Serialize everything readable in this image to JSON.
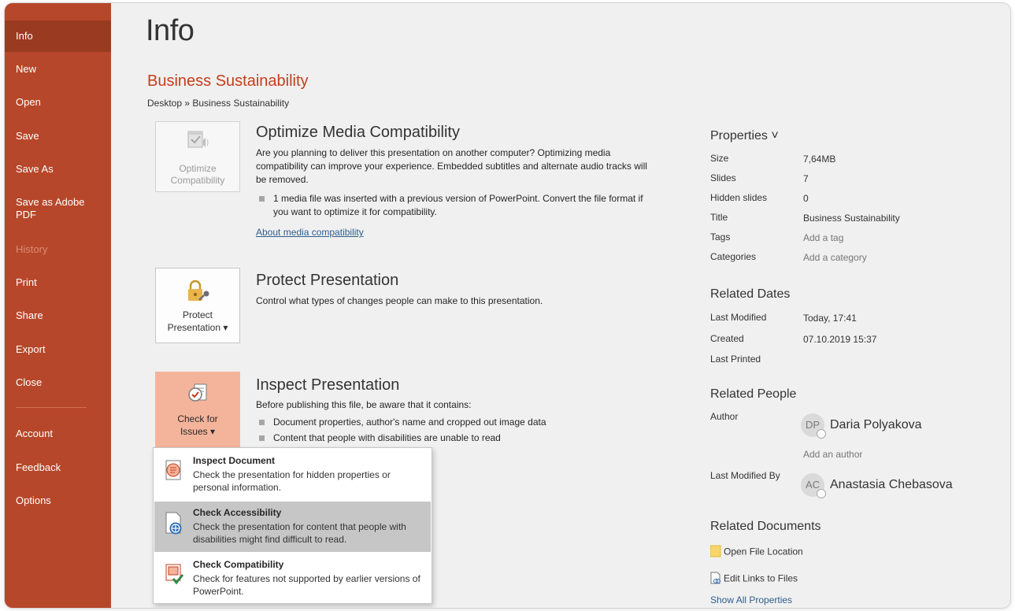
{
  "sidebar": {
    "items": [
      {
        "label": "Info",
        "state": "active"
      },
      {
        "label": "New"
      },
      {
        "label": "Open"
      },
      {
        "label": "Save"
      },
      {
        "label": "Save As"
      },
      {
        "label": "Save as Adobe PDF"
      },
      {
        "label": "History",
        "state": "disabled"
      },
      {
        "label": "Print"
      },
      {
        "label": "Share"
      },
      {
        "label": "Export"
      },
      {
        "label": "Close"
      },
      {
        "label": "Account"
      },
      {
        "label": "Feedback"
      },
      {
        "label": "Options"
      }
    ]
  },
  "main": {
    "page_title": "Info",
    "doc_title": "Business Sustainability",
    "breadcrumb": "Desktop » Business Sustainability",
    "optimize": {
      "tile_label_1": "Optimize",
      "tile_label_2": "Compatibility",
      "heading": "Optimize Media Compatibility",
      "description": "Are you planning to deliver this presentation on another computer? Optimizing media compatibility can improve your experience. Embedded subtitles and alternate audio tracks will be removed.",
      "bullet": "1 media file was inserted with a previous version of PowerPoint. Convert the file format if you want to optimize it for compatibility.",
      "link": "About media compatibility"
    },
    "protect": {
      "tile_label_1": "Protect",
      "tile_label_2": "Presentation ▾",
      "heading": "Protect Presentation",
      "description": "Control what types of changes people can make to this presentation."
    },
    "inspect": {
      "tile_label_1": "Check for",
      "tile_label_2": "Issues ▾",
      "heading": "Inspect Presentation",
      "description": "Before publishing this file, be aware that it contains:",
      "bullets": [
        "Document properties, author's name and cropped out image data",
        "Content that people with disabilities are unable to read"
      ]
    }
  },
  "dropdown": {
    "items": [
      {
        "title": "Inspect Document",
        "desc": "Check the presentation for hidden properties or personal information.",
        "icon": "inspect-document-icon"
      },
      {
        "title": "Check Accessibility",
        "desc": "Check the presentation for content that people with disabilities might find difficult to read.",
        "icon": "accessibility-icon",
        "hover": true
      },
      {
        "title": "Check Compatibility",
        "desc": "Check for features not supported by earlier versions of PowerPoint.",
        "icon": "compatibility-icon"
      }
    ]
  },
  "properties": {
    "heading": "Properties ˅",
    "rows": [
      {
        "key": "Size",
        "value": "7,64MB"
      },
      {
        "key": "Slides",
        "value": "7"
      },
      {
        "key": "Hidden slides",
        "value": "0"
      },
      {
        "key": "Title",
        "value": "Business Sustainability"
      },
      {
        "key": "Tags",
        "value": "Add a tag",
        "muted": true
      },
      {
        "key": "Categories",
        "value": "Add a category",
        "muted": true
      }
    ]
  },
  "related_dates": {
    "heading": "Related Dates",
    "rows": [
      {
        "key": "Last Modified",
        "value": "Today, 17:41"
      },
      {
        "key": "Created",
        "value": "07.10.2019 15:37"
      },
      {
        "key": "Last Printed",
        "value": ""
      }
    ]
  },
  "related_people": {
    "heading": "Related People",
    "author_label": "Author",
    "author_initials": "DP",
    "author_name": "Daria Polyakova",
    "add_author": "Add an author",
    "modified_by_label": "Last Modified By",
    "modified_initials": "AC",
    "modified_name": "Anastasia Chebasova"
  },
  "related_documents": {
    "heading": "Related Documents",
    "open_location": "Open File Location",
    "edit_links": "Edit Links to Files",
    "show_all": "Show All Properties"
  },
  "colors": {
    "sidebar": "#b7472a",
    "sidebar_active": "#9a3a20",
    "accent_title": "#c43e1c",
    "pressed_tile": "#f4b49b",
    "link": "#2e5e8e"
  }
}
